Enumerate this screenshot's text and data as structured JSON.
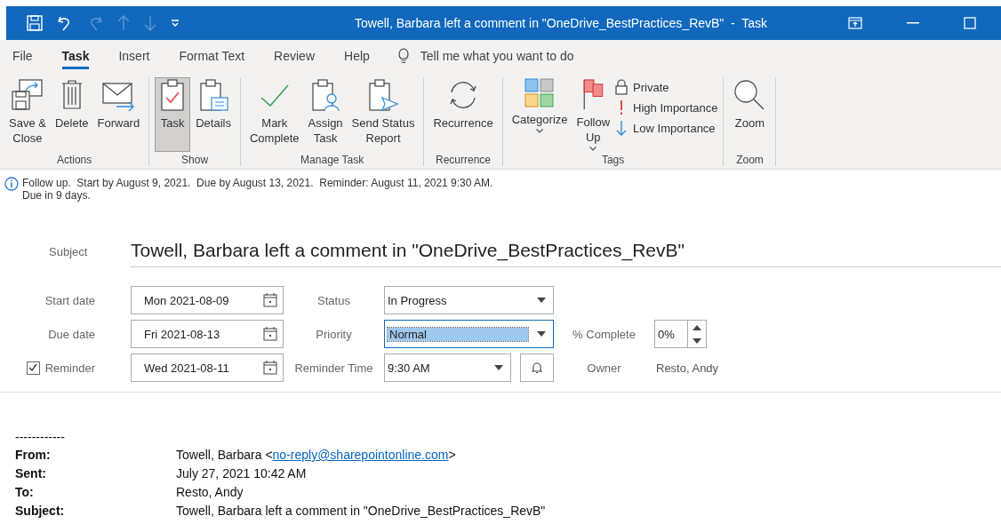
{
  "window": {
    "title": "Towell, Barbara left a comment in \"OneDrive_BestPractices_RevB\"  -  Task"
  },
  "tabs": [
    {
      "label": "File",
      "selected": false
    },
    {
      "label": "Task",
      "selected": true
    },
    {
      "label": "Insert",
      "selected": false
    },
    {
      "label": "Format Text",
      "selected": false
    },
    {
      "label": "Review",
      "selected": false
    },
    {
      "label": "Help",
      "selected": false
    }
  ],
  "tell_me": {
    "placeholder": "Tell me what you want to do"
  },
  "ribbon": [
    {
      "label": "Actions",
      "buttons": [
        {
          "lines": [
            "Save &",
            "Close"
          ],
          "selected": false
        },
        {
          "lines": [
            "Delete"
          ],
          "selected": false
        },
        {
          "lines": [
            "Forward"
          ],
          "selected": false
        }
      ]
    },
    {
      "label": "Show",
      "buttons": [
        {
          "lines": [
            "Task"
          ],
          "selected": true
        },
        {
          "lines": [
            "Details"
          ],
          "selected": false
        }
      ]
    },
    {
      "label": "Manage Task",
      "buttons": [
        {
          "lines": [
            "Mark",
            "Complete"
          ],
          "selected": false
        },
        {
          "lines": [
            "Assign",
            "Task"
          ],
          "selected": false
        },
        {
          "lines": [
            "Send Status",
            "Report"
          ],
          "selected": false
        }
      ]
    },
    {
      "label": "Recurrence",
      "buttons": [
        {
          "lines": [
            "Recurrence"
          ],
          "selected": false
        }
      ]
    },
    {
      "label": "Tags",
      "buttons": [
        {
          "lines": [
            "Categorize"
          ],
          "dropdown": true,
          "selected": false
        },
        {
          "lines": [
            "Follow",
            "Up"
          ],
          "dropdown": true,
          "selected": false
        }
      ],
      "small": [
        {
          "label": "Private"
        },
        {
          "label": "High Importance"
        },
        {
          "label": "Low Importance"
        }
      ]
    },
    {
      "label": "Zoom",
      "buttons": [
        {
          "lines": [
            "Zoom"
          ],
          "selected": false
        }
      ]
    }
  ],
  "info": {
    "lines": [
      "Follow up.  Start by August 9, 2021.  Due by August 13, 2021.  Reminder: August 11, 2021 9:30 AM.",
      "Due in 9 days."
    ]
  },
  "subject": {
    "label": "Subject",
    "value": "Towell, Barbara left a comment in \"OneDrive_BestPractices_RevB\""
  },
  "start_date": {
    "label": "Start date",
    "value": "Mon 2021-08-09"
  },
  "due_date": {
    "label": "Due date",
    "value": "Fri 2021-08-13"
  },
  "reminder": {
    "label": "Reminder",
    "checked": true,
    "value": "Wed 2021-08-11"
  },
  "status": {
    "label": "Status",
    "value": "In Progress",
    "focused": false
  },
  "priority": {
    "label": "Priority",
    "value": "Normal",
    "focused": true
  },
  "percent_complete": {
    "label": "% Complete",
    "value": "0%"
  },
  "reminder_time": {
    "label": "Reminder Time",
    "value": "9:30 AM"
  },
  "owner": {
    "label": "Owner",
    "value": "Resto, Andy"
  },
  "email": {
    "separator": "------------",
    "headers": [
      {
        "label": "From:",
        "value": "Towell, Barbara <",
        "link": "no-reply@sharepointonline.com",
        "after": ">"
      },
      {
        "label": "Sent:",
        "value": "July 27, 2021 10:42 AM"
      },
      {
        "label": "To:",
        "value": "Resto, Andy"
      },
      {
        "label": "Subject:",
        "value": "Towell, Barbara left a comment in \"OneDrive_BestPractices_RevB\""
      }
    ]
  }
}
